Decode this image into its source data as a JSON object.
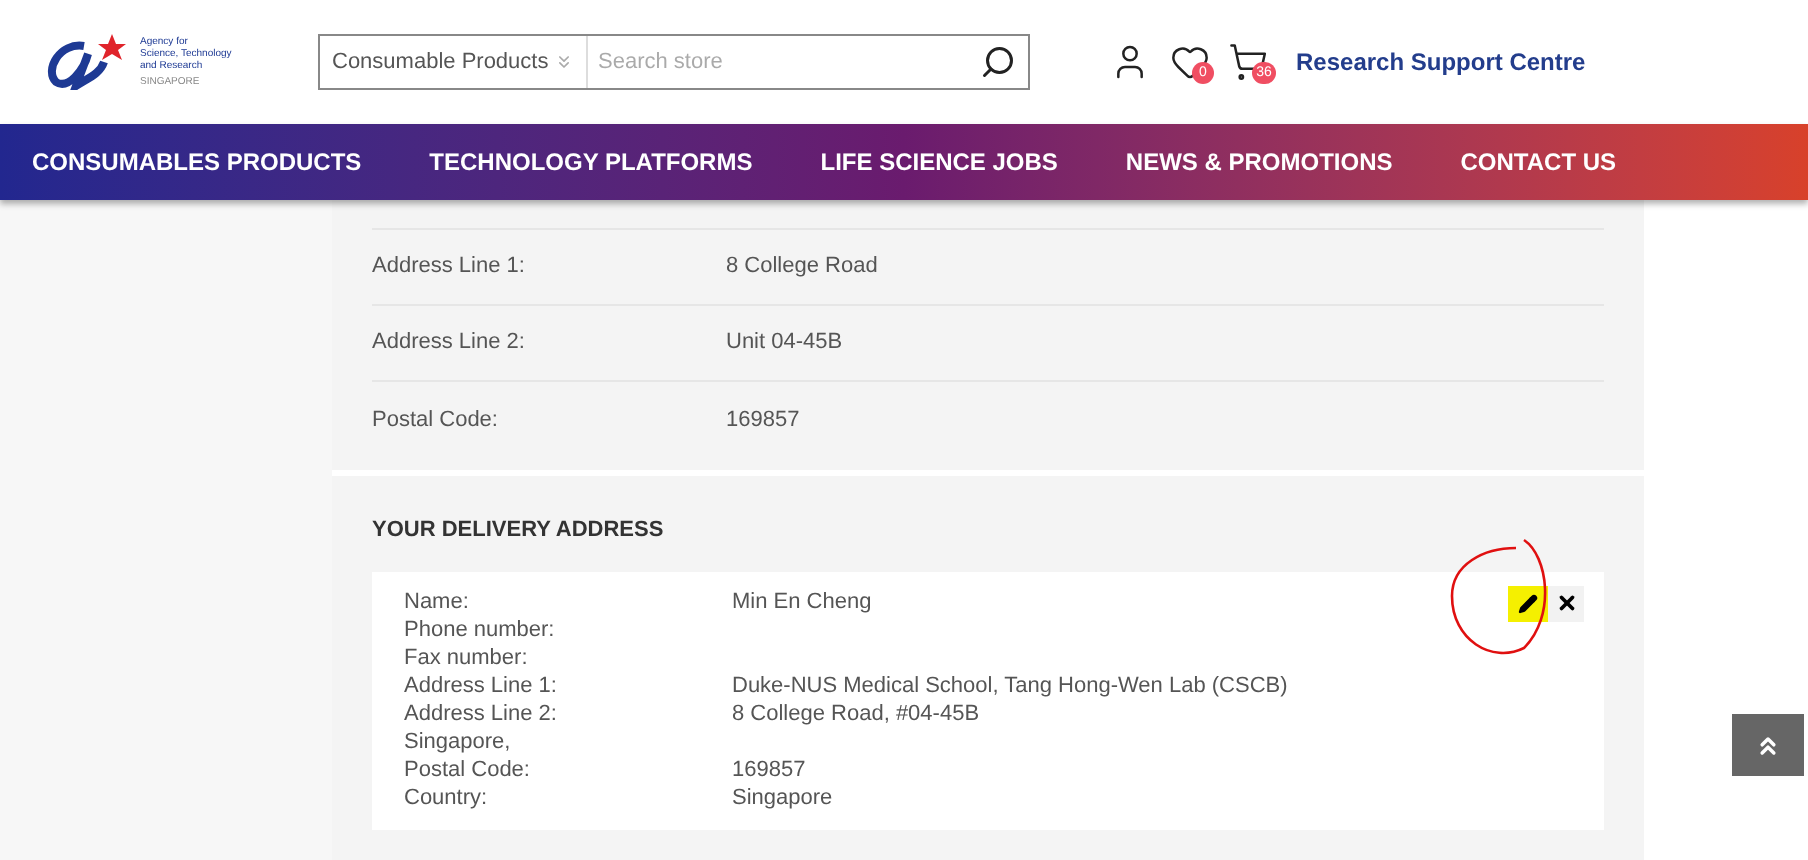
{
  "header": {
    "logo_lines": [
      "Agency for",
      "Science, Technology",
      "and Research",
      "SINGAPORE"
    ],
    "category_select": {
      "value": "Consumable Products"
    },
    "search": {
      "placeholder": "Search store"
    },
    "wishlist_count": "0",
    "cart_count": "36",
    "link": "Research Support Centre"
  },
  "nav": [
    "CONSUMABLES PRODUCTS",
    "TECHNOLOGY PLATFORMS",
    "LIFE SCIENCE JOBS",
    "NEWS & PROMOTIONS",
    "CONTACT US"
  ],
  "billing_rows": [
    {
      "label": "Address Line 1:",
      "value": "8 College Road"
    },
    {
      "label": "Address Line 2:",
      "value": "Unit 04-45B"
    },
    {
      "label": "Postal Code:",
      "value": "169857"
    }
  ],
  "delivery": {
    "heading": "YOUR DELIVERY ADDRESS",
    "fields": [
      {
        "label": "Name:",
        "value": "Min En Cheng"
      },
      {
        "label": "Phone number:"
      },
      {
        "label": "Fax number:"
      },
      {
        "label": "Address Line 1:",
        "value": "Duke-NUS Medical School, Tang Hong-Wen Lab (CSCB)"
      },
      {
        "label": "Address Line 2:",
        "value": "8 College Road, #04-45B"
      },
      {
        "label": "Singapore,"
      },
      {
        "label": "Postal Code:",
        "value": "169857"
      },
      {
        "label": "Country:",
        "value": "Singapore"
      }
    ],
    "edit_highlighted": true
  }
}
